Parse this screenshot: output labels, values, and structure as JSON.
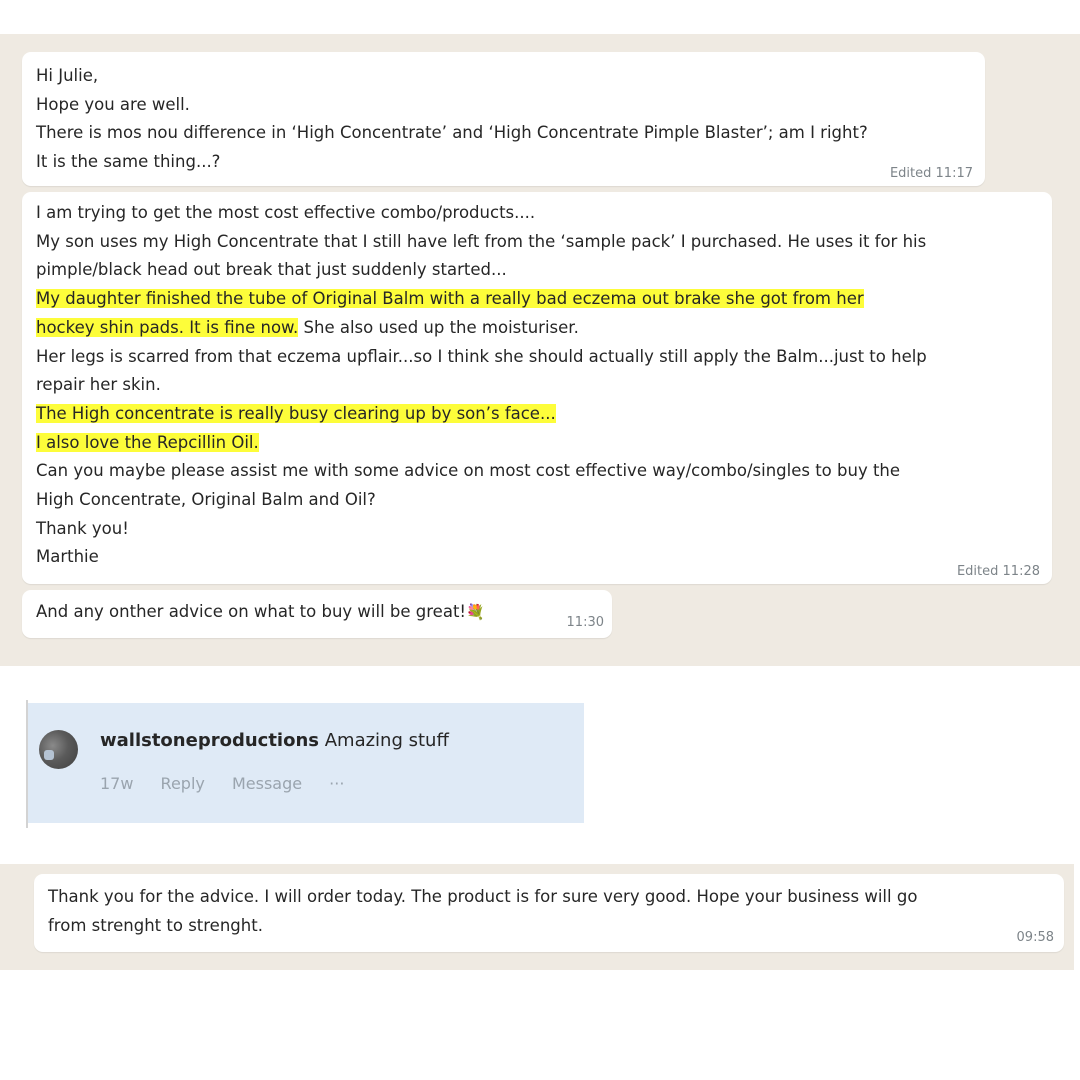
{
  "chat1": {
    "message1": {
      "lines": [
        "Hi Julie,",
        "Hope you are well.",
        "There is mos nou difference in ‘High Concentrate’ and ‘High Concentrate Pimple Blaster’; am I right?",
        "It is the same thing...?"
      ],
      "time": "Edited 11:17"
    },
    "message2": {
      "line1": "I am trying to get the most cost effective combo/products....",
      "line2": "My son uses my High Concentrate that I still have left from the ‘sample pack’ I purchased. He uses it for his",
      "line3": "pimple/black head out break that just suddenly started...",
      "line4": "My daughter finished the tube of Original Balm with a really bad eczema out brake she got from her",
      "line5_highlight": "hockey shin pads. It is fine now.",
      "line5_rest": " She also used up the moisturiser.",
      "line6": "Her legs is scarred from that eczema upflair...so I think she should actually still apply the Balm...just to help",
      "line7": "repair her skin.",
      "line8": "The High concentrate is really busy clearing up by son’s face...",
      "line9": "I also love the Repcillin Oil.",
      "line10": "Can you maybe please assist me with some advice on most cost effective way/combo/singles to buy the",
      "line11": "High Concentrate, Original Balm and Oil?",
      "line12": "Thank you!",
      "line13": "Marthie",
      "time": "Edited 11:28"
    },
    "message3": {
      "text": "And any onther advice on what to buy will be great!",
      "emoji": "💐",
      "time": "11:30"
    }
  },
  "comment": {
    "username": "wallstoneproductions",
    "text": " Amazing stuff",
    "age": "17w",
    "reply": "Reply",
    "message": "Message",
    "more": "···"
  },
  "chat2": {
    "message": {
      "lines": [
        "Thank you for the advice. I will order today. The product is for sure very good. Hope your business will go",
        "from strenght to strenght."
      ],
      "time": "09:58"
    }
  },
  "colors": {
    "chat_background": "#efeae2",
    "bubble": "#ffffff",
    "highlight": "#fdfd3a",
    "comment_background": "#dfeaf6"
  }
}
